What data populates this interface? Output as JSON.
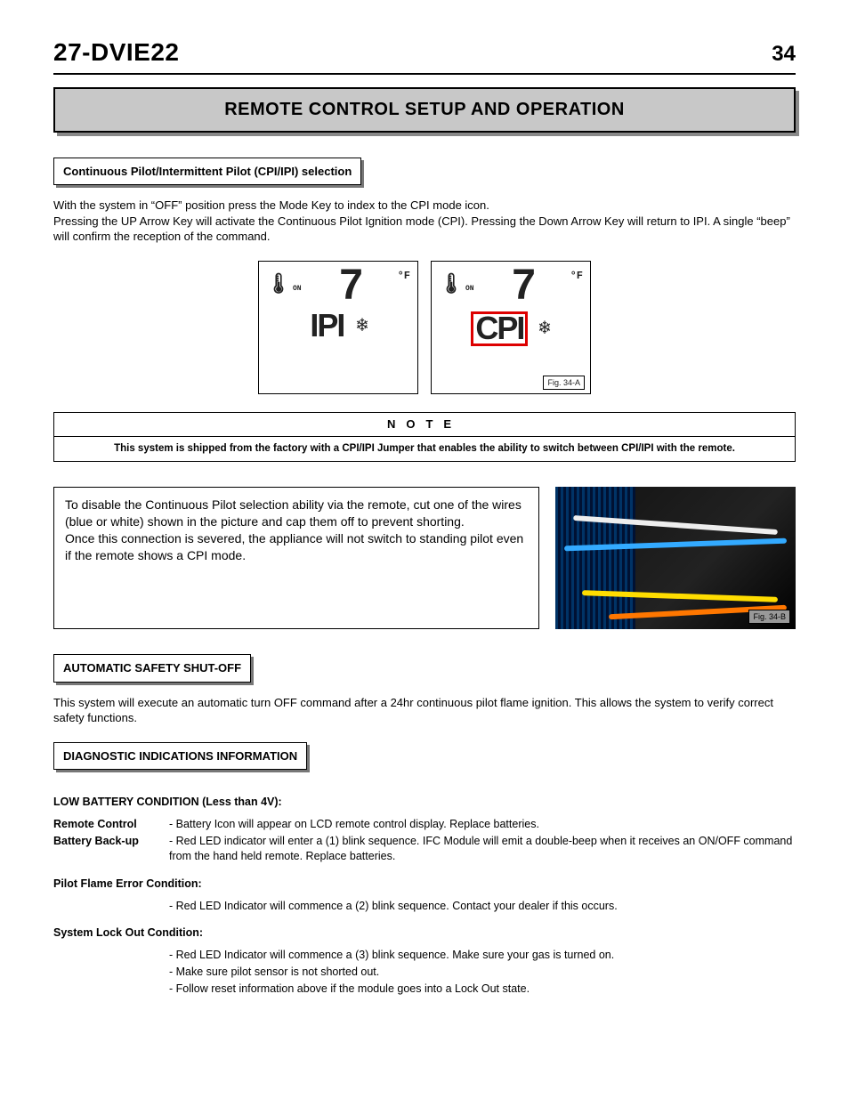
{
  "header": {
    "doc_code": "27-DVIE22",
    "page_number": "34"
  },
  "banner": "REMOTE CONTROL SETUP AND OPERATION",
  "section1": {
    "heading": "Continuous Pilot/Intermittent Pilot (CPI/IPI) selection",
    "p1": "With the system in “OFF” position press the Mode Key to index to the CPI mode icon.",
    "p2": "Pressing the UP Arrow Key will activate the Continuous Pilot Ignition mode (CPI). Pressing the Down Arrow Key will return to IPI. A single “beep” will confirm the reception of the command."
  },
  "lcd": {
    "on": "ON",
    "temp": "7",
    "unit": "°F",
    "mode_ipi": "IPI",
    "mode_cpi": "CPI",
    "fig_a": "Fig. 34-A"
  },
  "note": {
    "head": "NOTE",
    "body": "This system is shipped from the factory with a CPI/IPI Jumper that enables the ability to switch between CPI/IPI with the remote."
  },
  "disable_box": "To disable the Continuous Pilot selection ability via the remote, cut one of the wires (blue or white) shown in the picture and cap them off to prevent shorting.\nOnce this connection is severed, the appliance will not switch to standing pilot even if the remote shows a CPI mode.",
  "fig_b": "Fig. 34-B",
  "section2": {
    "heading": "AUTOMATIC SAFETY SHUT-OFF",
    "body": "This system will execute an automatic turn OFF command after a 24hr continuous pilot flame ignition. This allows the system to verify correct safety functions."
  },
  "section3": {
    "heading": "DIAGNOSTIC INDICATIONS INFORMATION",
    "low_batt_h": "LOW BATTERY CONDITION (Less than 4V):",
    "rows": [
      {
        "label": "Remote Control",
        "text": "- Battery Icon will appear on LCD remote control display. Replace batteries."
      },
      {
        "label": "Battery Back-up",
        "text": "- Red LED indicator will enter a (1) blink sequence. IFC Module will emit a double-beep when it receives an ON/OFF command from the hand held remote. Replace batteries."
      }
    ],
    "pilot_h": "Pilot Flame Error Condition:",
    "pilot_items": [
      "- Red LED Indicator will commence a (2) blink sequence. Contact your dealer if this occurs."
    ],
    "lockout_h": "System Lock Out Condition:",
    "lockout_items": [
      "- Red LED Indicator will commence a (3) blink sequence. Make sure your gas is turned on.",
      "- Make sure pilot sensor is not shorted out.",
      "- Follow reset information above if the module goes into a Lock Out state."
    ]
  }
}
